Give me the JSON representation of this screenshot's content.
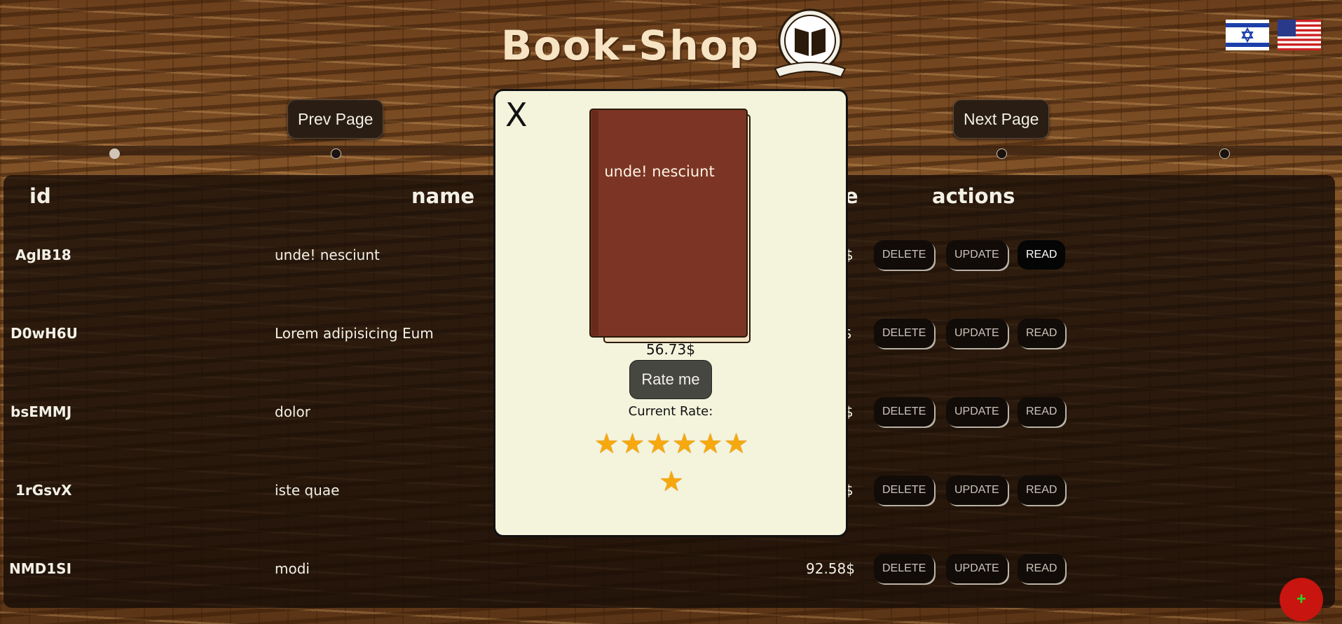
{
  "header": {
    "logo_text": "Book-Shop"
  },
  "flags": [
    {
      "name": "israel-flag"
    },
    {
      "name": "usa-flag"
    }
  ],
  "pagination": {
    "prev_label": "Prev Page",
    "next_label": "Next Page",
    "active_dot": 0,
    "dots": 5
  },
  "table": {
    "headers": {
      "id": "id",
      "name": "name",
      "price": "e",
      "actions": "actions"
    },
    "rows": [
      {
        "id": "AglB18",
        "name": "unde! nesciunt",
        "price": "$"
      },
      {
        "id": "D0wH6U",
        "name": "Lorem adipisicing Eum",
        "price": "$"
      },
      {
        "id": "bsEMMJ",
        "name": "dolor",
        "price": "$"
      },
      {
        "id": "1rGsvX",
        "name": "iste quae",
        "price": "$"
      },
      {
        "id": "NMD1SI",
        "name": "modi",
        "price": "92.58$"
      }
    ],
    "action_labels": {
      "delete": "DELETE",
      "update": "UPDATE",
      "read": "READ"
    }
  },
  "fab": {
    "label": "+"
  },
  "modal": {
    "close_label": "X",
    "book_title": "unde! nesciunt",
    "price": "56.73$",
    "rate_button": "Rate me",
    "current_rate_label": "Current Rate:",
    "rating": 7
  },
  "colors": {
    "accent_star": "#f6a80e",
    "fab_red": "#c8150f",
    "modal_bg": "#f4f4dd"
  }
}
